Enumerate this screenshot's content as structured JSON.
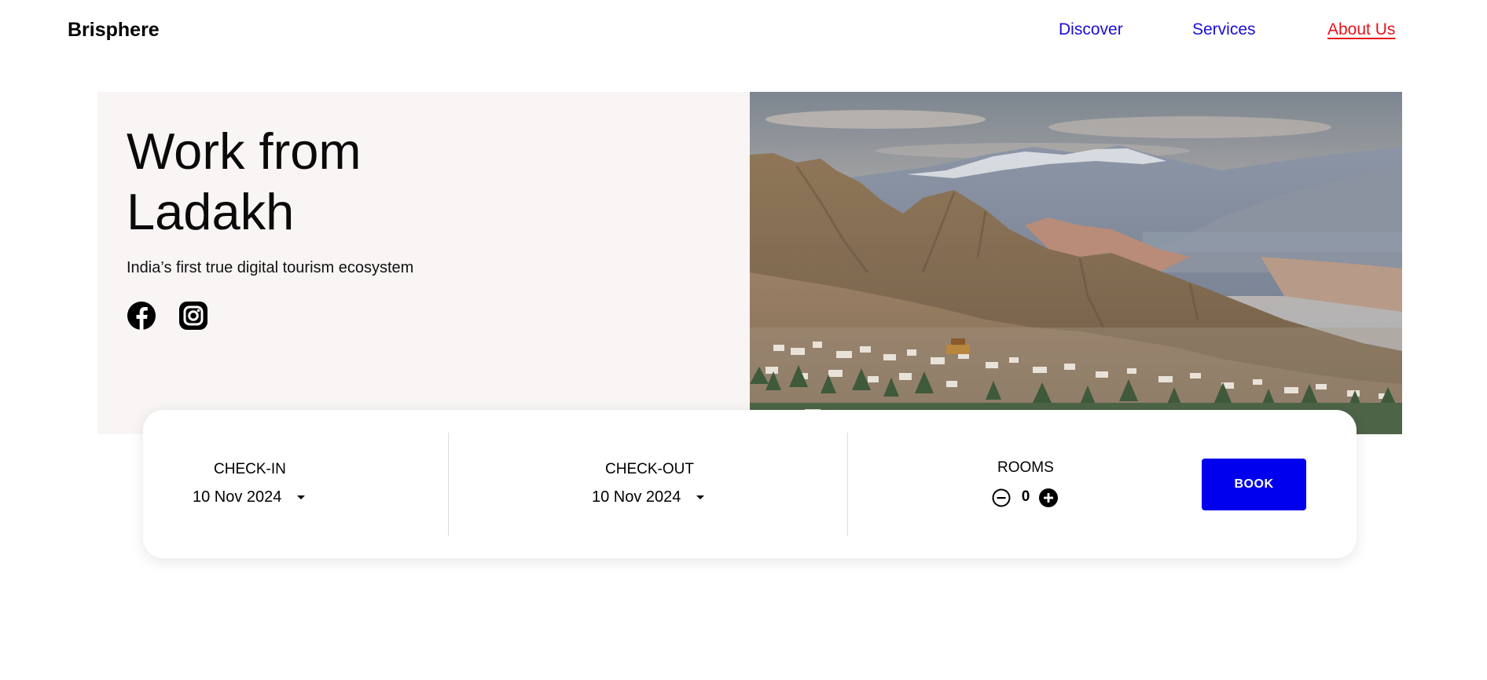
{
  "brand": {
    "name": "Brisphere"
  },
  "nav": {
    "discover": "Discover",
    "services": "Services",
    "about": "About Us"
  },
  "hero": {
    "title": "Work from Ladakh",
    "subtitle": "India’s first true digital tourism ecosystem",
    "social_icons": [
      "facebook-icon",
      "instagram-icon"
    ],
    "image": "mountain-town-landscape"
  },
  "booking": {
    "checkin": {
      "label": "CHECK-IN",
      "value": "10 Nov 2024"
    },
    "checkout": {
      "label": "CHECK-OUT",
      "value": "10 Nov 2024"
    },
    "rooms": {
      "label": "ROOMS",
      "count": "0"
    },
    "book_label": "BOOK"
  },
  "colors": {
    "nav_link": "#1a0dd6",
    "nav_active": "#e8141a",
    "book_button": "#0000ee",
    "hero_panel": "#f8f5f4"
  }
}
